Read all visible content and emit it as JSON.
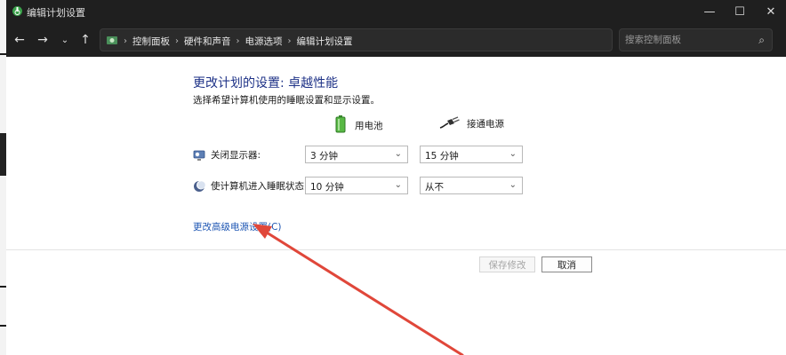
{
  "window": {
    "title": "编辑计划设置",
    "controls": {
      "minimize": "—",
      "maximize": "☐",
      "close": "✕"
    }
  },
  "addressbar": {
    "breadcrumbs": [
      "控制面板",
      "硬件和声音",
      "电源选项",
      "编辑计划设置"
    ],
    "search_placeholder": "搜索控制面板"
  },
  "plan": {
    "heading": "更改计划的设置: 卓越性能",
    "subheading": "选择希望计算机使用的睡眠设置和显示设置。"
  },
  "columns": {
    "battery": "用电池",
    "plugged_in": "接通电源"
  },
  "settings": [
    {
      "label": "关闭显示器:",
      "icon": "monitor-icon",
      "battery_value": "3 分钟",
      "plugged_value": "15 分钟"
    },
    {
      "label": "使计算机进入睡眠状态:",
      "icon": "moon-icon",
      "battery_value": "10 分钟",
      "plugged_value": "从不"
    }
  ],
  "advanced_link": "更改高级电源设置(C)",
  "buttons": {
    "save": "保存修改",
    "cancel": "取消"
  },
  "colors": {
    "titlebar": "#1f1f1f",
    "heading": "#1e3287",
    "link": "#1e56b3",
    "annotation_arrow": "#e0473a"
  }
}
